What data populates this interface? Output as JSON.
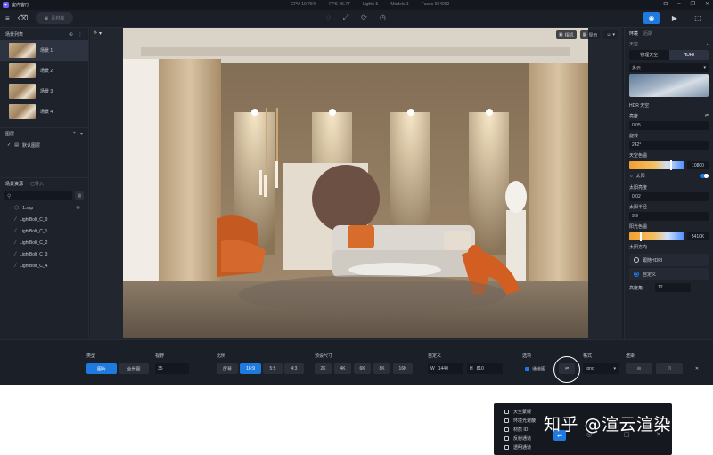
{
  "app": {
    "title": "室内客厅",
    "stats": [
      "GPU 19.75%",
      "FPS 45.77",
      "Lights 5",
      "Models 1",
      "Faces 934062"
    ],
    "logo_glyph": "✦"
  },
  "toolbar": {
    "pill_label": "素材库",
    "icons": [
      "lightbulb-icon",
      "expand-icon",
      "rotate-icon",
      "timer-icon"
    ],
    "right_icons": [
      "camera-icon",
      "video-icon",
      "save-icon"
    ]
  },
  "left_panel": {
    "scene_list_title": "场景列表",
    "scenes": [
      {
        "label": "场景 1",
        "active": true
      },
      {
        "label": "场景 2",
        "active": false
      },
      {
        "label": "场景 3",
        "active": false
      },
      {
        "label": "场景 4",
        "active": false
      }
    ],
    "layers_title": "图层",
    "layers": [
      {
        "label": "默认图层"
      }
    ],
    "resource_tabs": [
      "场景资源",
      "已导入"
    ],
    "tree": [
      {
        "label": "1.skp",
        "icon": "cube-icon",
        "indent": 0
      },
      {
        "label": "LightBolt_C_0",
        "icon": "line-icon",
        "indent": 1
      },
      {
        "label": "LightBolt_C_1",
        "icon": "line-icon",
        "indent": 1
      },
      {
        "label": "LightBolt_C_2",
        "icon": "line-icon",
        "indent": 1
      },
      {
        "label": "LightBolt_C_3",
        "icon": "line-icon",
        "indent": 1
      },
      {
        "label": "LightBolt_C_4",
        "icon": "line-icon",
        "indent": 1
      }
    ]
  },
  "viewport": {
    "chips": [
      {
        "icon": "camera-icon",
        "label": "相机"
      },
      {
        "icon": "display-icon",
        "label": "显示"
      },
      {
        "icon": "user-icon",
        "label": ""
      }
    ]
  },
  "right_panel": {
    "tabs": [
      "环境",
      "后期"
    ],
    "sky_section": "天空",
    "sky_modes": [
      {
        "label": "物理天空",
        "active": false
      },
      {
        "label": "HDRI",
        "active": true
      }
    ],
    "sky_preset": "多云",
    "hdr_title": "HDR 天空",
    "brightness_label": "亮度",
    "brightness_value": "0.05",
    "rotation_label": "旋转",
    "rotation_value": "242°",
    "sky_color_label": "天空色温",
    "sky_color_value": "10800",
    "sky_color_position": 0.74,
    "sun_label": "太阳",
    "sun_brightness_label": "太阳亮度",
    "sun_brightness_value": "0.02",
    "sun_radius_label": "太阳半径",
    "sun_radius_value": "9.9",
    "sun_color_label": "阳光色温",
    "sun_color_value": "5410K",
    "sun_color_position": 0.2,
    "sun_dir_label": "太阳方向",
    "dir_options": [
      {
        "label": "跟随HDRI",
        "on": false
      },
      {
        "label": "自定义",
        "on": true
      }
    ],
    "altitude_label": "高度角",
    "altitude_value": "12"
  },
  "bottom": {
    "type_label": "类型",
    "type_options": [
      {
        "label": "图片",
        "active": true
      },
      {
        "label": "全景图",
        "active": false
      }
    ],
    "fov_label": "视野",
    "fov_value": "35",
    "ratio_label": "比例",
    "ratio_options": [
      {
        "label": "屏幕",
        "active": false
      },
      {
        "label": "16:9",
        "active": true
      },
      {
        "label": "5:5",
        "active": false
      },
      {
        "label": "4:3",
        "active": false
      }
    ],
    "size_label": "预设尺寸",
    "size_options": [
      "2K",
      "4K",
      "6K",
      "8K",
      "16K"
    ],
    "custom_label": "自定义",
    "w_label": "W",
    "w_value": "1440",
    "h_label": "H",
    "h_value": "810",
    "options_label": "选项",
    "channel_label": "通道图",
    "format_label": "格式",
    "format_value": ".png",
    "render_label": "渲染"
  },
  "popup": {
    "items": [
      "天空蒙版",
      "环境光遮蔽",
      "材质 ID",
      "反射通道",
      "透明通道"
    ]
  },
  "watermark": "知乎 @渲云渲染"
}
